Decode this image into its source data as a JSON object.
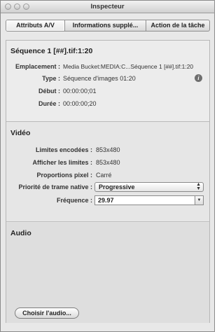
{
  "window": {
    "title": "Inspecteur"
  },
  "tabs": [
    {
      "label": "Attributs A/V",
      "active": true
    },
    {
      "label": "Informations supplé...",
      "active": false
    },
    {
      "label": "Action de la tâche",
      "active": false
    }
  ],
  "sequence": {
    "title": "Séquence 1 [##].tif:1:20",
    "rows": [
      {
        "label": "Emplacement :",
        "value": "Media Bucket:MEDIA:C...Séquence 1 [##].tif:1:20"
      },
      {
        "label": "Type :",
        "value": "Séquence d'images 01:20"
      },
      {
        "label": "Début :",
        "value": "00:00:00;01"
      },
      {
        "label": "Durée :",
        "value": "00:00:00;20"
      }
    ],
    "info_icon": "info-icon"
  },
  "video": {
    "title": "Vidéo",
    "rows": [
      {
        "label": "Limites encodées :",
        "value": "853x480"
      },
      {
        "label": "Afficher les limites :",
        "value": "853x480"
      },
      {
        "label": "Proportions pixel :",
        "value": "Carré"
      }
    ],
    "field_order": {
      "label": "Priorité de trame native :",
      "selected": "Progressive"
    },
    "frame_rate": {
      "label": "Fréquence :",
      "value": "29.97"
    }
  },
  "audio": {
    "title": "Audio",
    "choose_button": "Choisir l'audio..."
  }
}
